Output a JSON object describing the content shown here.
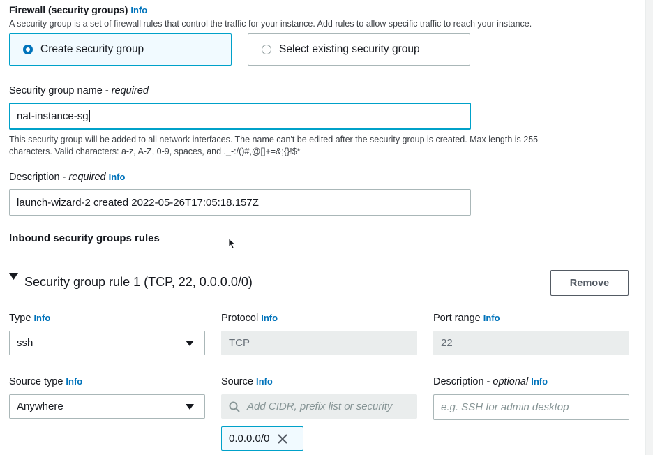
{
  "firewall": {
    "title": "Firewall (security groups)",
    "info": "Info",
    "description": "A security group is a set of firewall rules that control the traffic for your instance. Add rules to allow specific traffic to reach your instance.",
    "options": {
      "create": "Create security group",
      "select": "Select existing security group"
    },
    "selected": "create"
  },
  "sg_name": {
    "label": "Security group name",
    "required": "required",
    "value": "nat-instance-sg",
    "help_line1": "This security group will be added to all network interfaces. The name can't be edited after the security group is created. Max length is 255",
    "help_line2": "characters. Valid characters: a-z, A-Z, 0-9, spaces, and ._-:/()#,@[]+=&;{}!$*"
  },
  "description": {
    "label": "Description",
    "required": "required",
    "info": "Info",
    "value": "launch-wizard-2 created 2022-05-26T17:05:18.157Z"
  },
  "inbound": {
    "title": "Inbound security groups rules"
  },
  "rule": {
    "title": "Security group rule 1 (TCP, 22, 0.0.0.0/0)",
    "remove": "Remove",
    "type_label": "Type",
    "type_value": "ssh",
    "protocol_label": "Protocol",
    "protocol_value": "TCP",
    "port_label": "Port range",
    "port_value": "22",
    "source_type_label": "Source type",
    "source_type_value": "Anywhere",
    "source_label": "Source",
    "source_placeholder": "Add CIDR, prefix list or security",
    "source_token": "0.0.0.0/0",
    "desc_label": "Description",
    "desc_optional": "optional",
    "desc_placeholder": "e.g. SSH for admin desktop",
    "info": "Info"
  },
  "colors": {
    "accent": "#0073bb",
    "selected_bg": "#f1faff",
    "focus_border": "#00a1c9"
  },
  "icons": [
    "triangle-down-icon",
    "search-icon",
    "close-icon",
    "cursor-icon",
    "caret-down-icon"
  ]
}
